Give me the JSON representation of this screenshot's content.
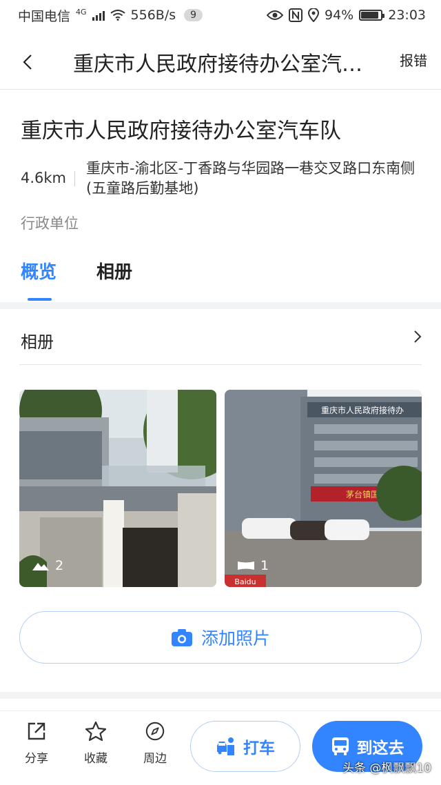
{
  "status_bar": {
    "carrier": "中国电信",
    "network": "4G",
    "speed": "556B/s",
    "notification_count": "9",
    "battery": "94%",
    "time": "23:03",
    "icons": [
      "signal-icon",
      "wifi-icon",
      "eye-icon",
      "nfc-icon",
      "location-icon",
      "battery-icon"
    ]
  },
  "header": {
    "title": "重庆市人民政府接待办公室汽车队",
    "report_label": "报错"
  },
  "place": {
    "name": "重庆市人民政府接待办公室汽车队",
    "distance": "4.6km",
    "address": "重庆市-渝北区-丁香路与华园路一巷交叉路口东南侧(五童路后勤基地)",
    "category": "行政单位"
  },
  "tabs": [
    {
      "label": "概览",
      "active": true
    },
    {
      "label": "相册",
      "active": false
    }
  ],
  "album": {
    "title": "相册",
    "photos": [
      {
        "count": "2",
        "icon": "mountain-icon"
      },
      {
        "count": "1",
        "icon": "panorama-icon"
      }
    ],
    "photo2_sign_text": "重庆市人民政府接待办",
    "photo2_shop_text": "茅台镇国",
    "photo_logo_text": "Baidu"
  },
  "add_photo": {
    "label": "添加照片"
  },
  "bottom_bar": {
    "share_label": "分享",
    "favorite_label": "收藏",
    "nearby_label": "周边",
    "taxi_label": "打车",
    "go_label": "到这去"
  },
  "watermark": "头条 @枫飘飘10",
  "colors": {
    "accent": "#3385ff",
    "accent_border": "#b3cff5",
    "text": "#222222",
    "muted": "#888888",
    "band": "#f2f3f5"
  }
}
